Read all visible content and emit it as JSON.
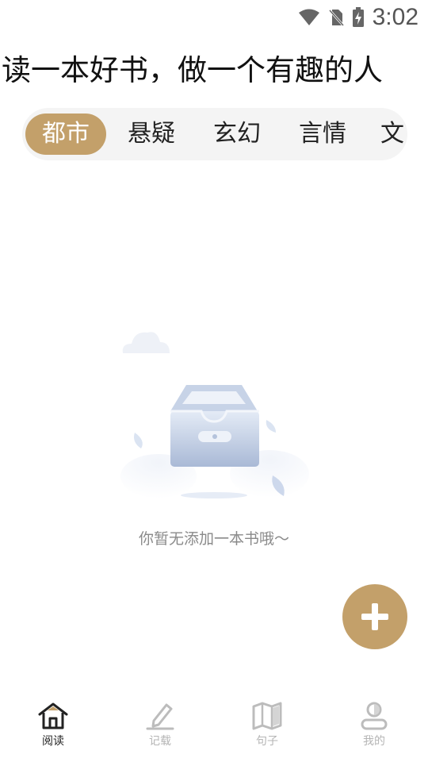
{
  "status_bar": {
    "time": "3:02",
    "icons": [
      "wifi-icon",
      "no-sim-icon",
      "battery-charging-icon"
    ]
  },
  "header": {
    "slogan": "读一本好书，做一个有趣的人"
  },
  "category_tabs": {
    "items": [
      {
        "label": "都市",
        "active": true
      },
      {
        "label": "悬疑",
        "active": false
      },
      {
        "label": "玄幻",
        "active": false
      },
      {
        "label": "言情",
        "active": false
      },
      {
        "label": "文",
        "active": false
      }
    ]
  },
  "empty_state": {
    "icon": "empty-box-icon",
    "text": "你暂无添加一本书哦～"
  },
  "fab": {
    "icon": "plus-icon"
  },
  "bottom_nav": {
    "items": [
      {
        "label": "阅读",
        "icon": "home-icon",
        "active": true
      },
      {
        "label": "记载",
        "icon": "pen-icon",
        "active": false
      },
      {
        "label": "句子",
        "icon": "book-open-icon",
        "active": false
      },
      {
        "label": "我的",
        "icon": "user-icon",
        "active": false
      }
    ]
  },
  "colors": {
    "accent": "#c3a06a",
    "tab_background": "#f4f4f4",
    "text_primary": "#222222",
    "text_muted": "#8a8a8a",
    "nav_inactive": "#b5b5b5"
  }
}
